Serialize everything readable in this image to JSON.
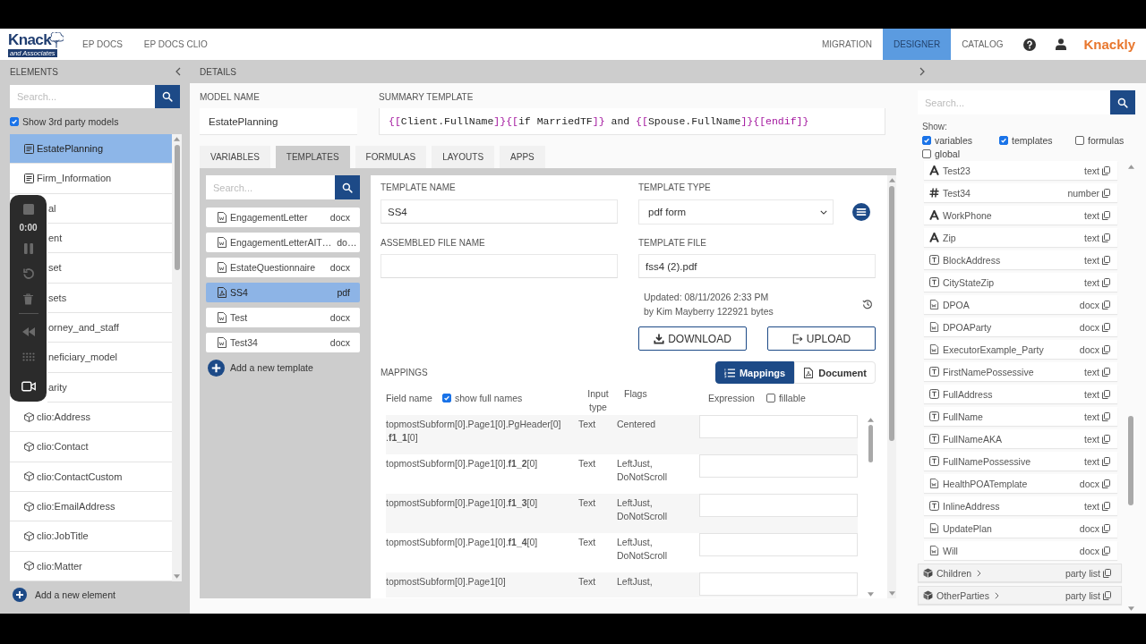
{
  "top_bar": {
    "logo": {
      "name": "Knack",
      "tagline": "and Associates"
    },
    "nav": [
      {
        "label": "EP DOCS",
        "selected": false
      },
      {
        "label": "EP DOCS CLIO",
        "selected": false
      }
    ],
    "nav_right": [
      {
        "label": "MIGRATION",
        "selected": false
      },
      {
        "label": "DESIGNER",
        "selected": true
      },
      {
        "label": "CATALOG",
        "selected": false
      }
    ],
    "brand": "Knackly"
  },
  "recorder": {
    "time": "0:00"
  },
  "elements_panel": {
    "title": "ELEMENTS",
    "search": {
      "placeholder": "Search..."
    },
    "show_third_party": {
      "label": "Show 3rd party models",
      "checked": true
    },
    "items": [
      {
        "label": "EstatePlanning",
        "kind": "model",
        "selected": true
      },
      {
        "label": "Firm_Information",
        "kind": "model",
        "selected": false
      },
      {
        "label": "al",
        "kind": "covered",
        "selected": false
      },
      {
        "label": "ent",
        "kind": "covered",
        "selected": false
      },
      {
        "label": "set",
        "kind": "covered",
        "selected": false
      },
      {
        "label": "sets",
        "kind": "covered",
        "selected": false
      },
      {
        "label": "orney_and_staff",
        "kind": "covered",
        "selected": false
      },
      {
        "label": "neficiary_model",
        "kind": "covered",
        "selected": false
      },
      {
        "label": "arity",
        "kind": "covered",
        "selected": false
      },
      {
        "label": "clio:Address",
        "kind": "cube",
        "selected": false
      },
      {
        "label": "clio:Contact",
        "kind": "cube",
        "selected": false
      },
      {
        "label": "clio:ContactCustom",
        "kind": "cube",
        "selected": false
      },
      {
        "label": "clio:EmailAddress",
        "kind": "cube",
        "selected": false
      },
      {
        "label": "clio:JobTitle",
        "kind": "cube",
        "selected": false
      },
      {
        "label": "clio:Matter",
        "kind": "cube",
        "selected": false
      }
    ],
    "add_label": "Add a new element"
  },
  "details": {
    "title": "DETAILS",
    "model_name": {
      "label": "MODEL NAME",
      "value": "EstatePlanning"
    },
    "summary_template": {
      "label": "SUMMARY TEMPLATE",
      "segments": [
        {
          "text": "{[",
          "kind": "delimiter"
        },
        {
          "text": "Client.FullName",
          "kind": "expression"
        },
        {
          "text": "]}{[",
          "kind": "delimiter"
        },
        {
          "text": "if MarriedTF",
          "kind": "expression"
        },
        {
          "text": "]}",
          "kind": "delimiter"
        },
        {
          "text": " and ",
          "kind": "plain"
        },
        {
          "text": "{[",
          "kind": "delimiter"
        },
        {
          "text": "Spouse.FullName",
          "kind": "expression"
        },
        {
          "text": "]}{[endif]}",
          "kind": "delimiter"
        }
      ]
    },
    "tabs": [
      {
        "label": "VARIABLES",
        "selected": false
      },
      {
        "label": "TEMPLATES",
        "selected": true
      },
      {
        "label": "FORMULAS",
        "selected": false
      },
      {
        "label": "LAYOUTS",
        "selected": false
      },
      {
        "label": "APPS",
        "selected": false
      }
    ]
  },
  "template_list": {
    "search": {
      "placeholder": "Search..."
    },
    "items": [
      {
        "name": "EngagementLetter",
        "type": "docx",
        "kind": "docx",
        "selected": false
      },
      {
        "name": "EngagementLetterAIT…",
        "type": "do…",
        "kind": "docx",
        "selected": false
      },
      {
        "name": "EstateQuestionnaire",
        "type": "docx",
        "kind": "docx",
        "selected": false
      },
      {
        "name": "SS4",
        "type": "pdf",
        "kind": "pdf",
        "selected": true
      },
      {
        "name": "Test",
        "type": "docx",
        "kind": "docx",
        "selected": false
      },
      {
        "name": "Test34",
        "type": "docx",
        "kind": "docx",
        "selected": false
      }
    ],
    "add_label": "Add a new template"
  },
  "template_form": {
    "name": {
      "label": "TEMPLATE NAME",
      "value": "SS4"
    },
    "type": {
      "label": "TEMPLATE TYPE",
      "value": "pdf form"
    },
    "assembled_file_name": {
      "label": "ASSEMBLED FILE NAME"
    },
    "file": {
      "label": "TEMPLATE FILE",
      "value": "fss4 (2).pdf"
    },
    "updated": "Updated: 08/11/2026 2:33 PM",
    "updated_by": "by Kim Mayberry 122921 bytes",
    "buttons": [
      {
        "label": "DOWNLOAD",
        "kind": "download"
      },
      {
        "label": "UPLOAD",
        "kind": "upload"
      }
    ]
  },
  "mappings": {
    "title": "MAPPINGS",
    "views": [
      {
        "label": "Mappings",
        "kind": "list",
        "selected": true
      },
      {
        "label": "Document",
        "kind": "document",
        "selected": false
      }
    ],
    "header": {
      "field_name": "Field name",
      "show_full_names": {
        "label": "show full names",
        "checked": true
      },
      "input_type": "Input type",
      "flags": "Flags",
      "expression": "Expression",
      "fillable": {
        "label": "fillable",
        "checked": false
      }
    },
    "rows": [
      {
        "field_name": [
          "topmostSubform[0].Page1[0].PgHeader[0]",
          ".**f1_1**[0]"
        ],
        "input_type": "Text",
        "flags": "Centered"
      },
      {
        "field_name": [
          "topmostSubform[0].Page1[0].**f1_2**[0]"
        ],
        "input_type": "Text",
        "flags": "LeftJust, DoNotScroll"
      },
      {
        "field_name": [
          "topmostSubform[0].Page1[0].**f1_3**[0]"
        ],
        "input_type": "Text",
        "flags": "LeftJust, DoNotScroll"
      },
      {
        "field_name": [
          "topmostSubform[0].Page1[0].**f1_4**[0]"
        ],
        "input_type": "Text",
        "flags": "LeftJust, DoNotScroll"
      },
      {
        "field_name": [
          "topmostSubform[0].Page1[0]"
        ],
        "input_type": "Text",
        "flags": "LeftJust,"
      }
    ]
  },
  "variables_panel": {
    "search": {
      "placeholder": "Search..."
    },
    "show_label": "Show:",
    "filters": [
      {
        "label": "variables",
        "checked": true
      },
      {
        "label": "templates",
        "checked": true
      },
      {
        "label": "formulas",
        "checked": false
      },
      {
        "label": "global",
        "checked": false
      }
    ],
    "items": [
      {
        "name": "Test23",
        "type": "text",
        "kind": "text"
      },
      {
        "name": "Test34",
        "type": "number",
        "kind": "number"
      },
      {
        "name": "WorkPhone",
        "type": "text",
        "kind": "text"
      },
      {
        "name": "Zip",
        "type": "text",
        "kind": "text"
      },
      {
        "name": "BlockAddress",
        "type": "text",
        "kind": "snippet"
      },
      {
        "name": "CityStateZip",
        "type": "text",
        "kind": "snippet"
      },
      {
        "name": "DPOA",
        "type": "docx",
        "kind": "document"
      },
      {
        "name": "DPOAParty",
        "type": "docx",
        "kind": "document"
      },
      {
        "name": "ExecutorExample_Party",
        "type": "docx",
        "kind": "document"
      },
      {
        "name": "FirstNamePossessive",
        "type": "text",
        "kind": "snippet"
      },
      {
        "name": "FullAddress",
        "type": "text",
        "kind": "snippet"
      },
      {
        "name": "FullName",
        "type": "text",
        "kind": "snippet"
      },
      {
        "name": "FullNameAKA",
        "type": "text",
        "kind": "snippet"
      },
      {
        "name": "FullNamePossessive",
        "type": "text",
        "kind": "snippet"
      },
      {
        "name": "HealthPOATemplate",
        "type": "docx",
        "kind": "document"
      },
      {
        "name": "InlineAddress",
        "type": "text",
        "kind": "snippet"
      },
      {
        "name": "UpdatePlan",
        "type": "docx",
        "kind": "document"
      },
      {
        "name": "Will",
        "type": "docx",
        "kind": "document"
      },
      {
        "name": "Children",
        "type": "party list",
        "kind": "party"
      },
      {
        "name": "OtherParties",
        "type": "party list",
        "kind": "party"
      }
    ]
  }
}
